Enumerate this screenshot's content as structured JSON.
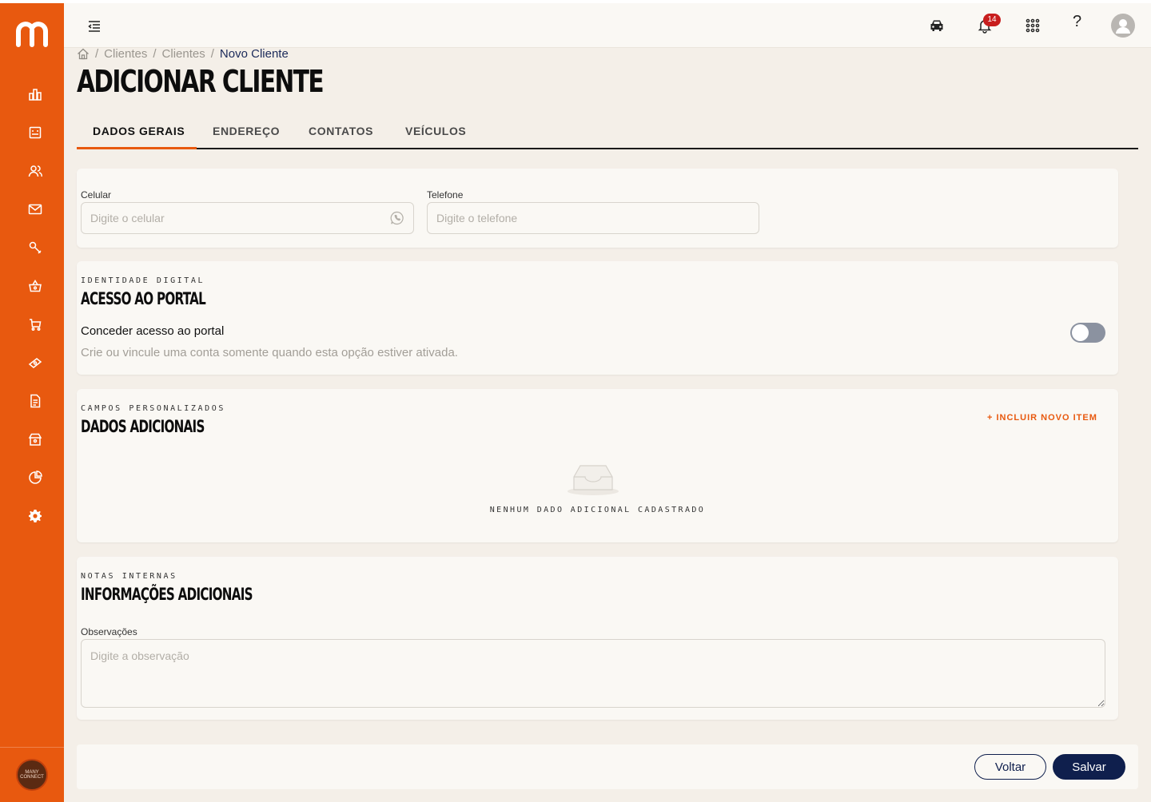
{
  "app": {
    "brand_color": "#e8590f",
    "logo_icon": "m-logo",
    "org_logo_text": "MANY CONNECT"
  },
  "sidebar": {
    "items": [
      {
        "name": "dashboard",
        "icon": "bar-chart-icon"
      },
      {
        "name": "calendar",
        "icon": "calendar-icon"
      },
      {
        "name": "clients",
        "icon": "users-icon"
      },
      {
        "name": "messages",
        "icon": "mail-icon"
      },
      {
        "name": "services",
        "icon": "wrench-icon"
      },
      {
        "name": "parts",
        "icon": "basket-icon"
      },
      {
        "name": "cart",
        "icon": "cart-icon"
      },
      {
        "name": "finance",
        "icon": "money-icon"
      },
      {
        "name": "documents",
        "icon": "document-icon"
      },
      {
        "name": "store",
        "icon": "store-icon"
      },
      {
        "name": "reports",
        "icon": "pie-chart-icon"
      },
      {
        "name": "settings",
        "icon": "gear-icon"
      }
    ]
  },
  "topbar": {
    "notification_count": "14",
    "help_label": "?"
  },
  "breadcrumb": {
    "items": [
      "Clientes",
      "Clientes"
    ],
    "current": "Novo Cliente",
    "separator": "/"
  },
  "page": {
    "title": "ADICIONAR CLIENTE"
  },
  "tabs": [
    {
      "label": "DADOS GERAIS",
      "active": true
    },
    {
      "label": "ENDEREÇO",
      "active": false
    },
    {
      "label": "CONTATOS",
      "active": false
    },
    {
      "label": "VEÍCULOS",
      "active": false
    }
  ],
  "contact_card": {
    "celular_label": "Celular",
    "celular_placeholder": "Digite o celular",
    "celular_value": "",
    "telefone_label": "Telefone",
    "telefone_placeholder": "Digite o telefone",
    "telefone_value": ""
  },
  "portal_card": {
    "eyebrow": "IDENTIDADE DIGITAL",
    "title": "ACESSO AO PORTAL",
    "option_title": "Conceder acesso ao portal",
    "option_desc": "Crie ou vincule uma conta somente quando esta opção estiver ativada.",
    "toggle_on": false
  },
  "custom_fields_card": {
    "eyebrow": "CAMPOS PERSONALIZADOS",
    "title": "DADOS ADICIONAIS",
    "add_label": "+  INCLUIR NOVO ITEM",
    "empty_text": "NENHUM DADO ADICIONAL CADASTRADO"
  },
  "notes_card": {
    "eyebrow": "NOTAS INTERNAS",
    "title": "INFORMAÇÕES ADICIONAIS",
    "obs_label": "Observações",
    "obs_placeholder": "Digite a observação",
    "obs_value": ""
  },
  "footer": {
    "back_label": "Voltar",
    "save_label": "Salvar"
  }
}
